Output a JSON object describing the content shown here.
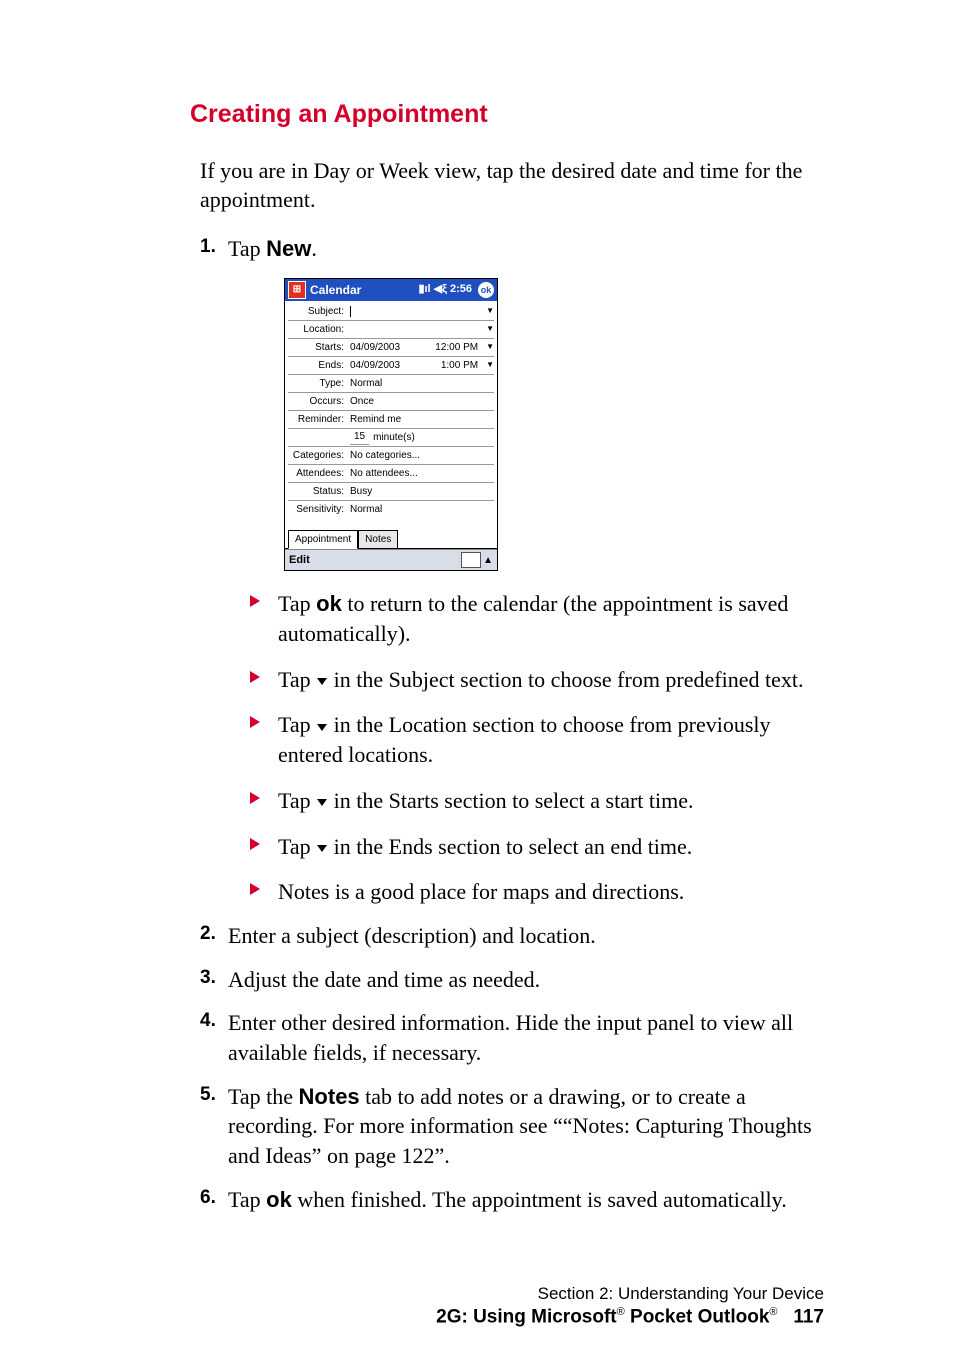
{
  "heading": "Creating an Appointment",
  "intro": "If you are in Day or Week view, tap the desired date and time for the appointment.",
  "steps": {
    "s1_pre": "Tap ",
    "s1_bold": "New",
    "s1_post": "."
  },
  "device": {
    "title": "Calendar",
    "time": "2:56",
    "ok": "ok",
    "rows": {
      "subject_label": "Subject:",
      "location_label": "Location:",
      "starts_label": "Starts:",
      "starts_date": "04/09/2003",
      "starts_time": "12:00 PM",
      "ends_label": "Ends:",
      "ends_date": "04/09/2003",
      "ends_time": "1:00 PM",
      "type_label": "Type:",
      "type_value": "Normal",
      "occurs_label": "Occurs:",
      "occurs_value": "Once",
      "reminder_label": "Reminder:",
      "reminder_value": "Remind me",
      "reminder_qty": "15",
      "reminder_unit": "minute(s)",
      "categories_label": "Categories:",
      "categories_value": "No categories...",
      "attendees_label": "Attendees:",
      "attendees_value": "No attendees...",
      "status_label": "Status:",
      "status_value": "Busy",
      "sensitivity_label": "Sensitivity:",
      "sensitivity_value": "Normal"
    },
    "tabs": {
      "appointment": "Appointment",
      "notes": "Notes"
    },
    "edit": "Edit"
  },
  "bullets": {
    "b1_pre": "Tap ",
    "b1_bold": "ok",
    "b1_post": " to return to the calendar (the appointment is saved automatically).",
    "b2_pre": "Tap ",
    "b2_post": " in the Subject section to choose from predefined text.",
    "b3_pre": "Tap ",
    "b3_post": " in the Location section to choose from previously entered locations.",
    "b4_pre": "Tap ",
    "b4_post": " in the Starts section to select a start time.",
    "b5_pre": "Tap ",
    "b5_post": " in the Ends section to select an end time.",
    "b6": "Notes is a good place for maps and directions."
  },
  "steps_rest": {
    "s2": "Enter a subject (description) and location.",
    "s3": "Adjust the date and time as needed.",
    "s4": "Enter other desired information. Hide the input panel to view all available fields, if necessary.",
    "s5_pre": "Tap the ",
    "s5_bold": "Notes",
    "s5_post": " tab to add notes or a drawing, or to create a recording. For more information see ““Notes: Capturing Thoughts and Ideas” on page 122”.",
    "s6_pre": "Tap ",
    "s6_bold": "ok",
    "s6_post": " when finished. The appointment is saved automatically."
  },
  "footer": {
    "section": "Section 2: Understanding Your Device",
    "chapter_bold": "2G: Using Microsoft",
    "reg": "®",
    "chapter_bold2": " Pocket Outlook",
    "page": "117"
  },
  "nums": {
    "n1": "1.",
    "n2": "2.",
    "n3": "3.",
    "n4": "4.",
    "n5": "5.",
    "n6": "6."
  }
}
